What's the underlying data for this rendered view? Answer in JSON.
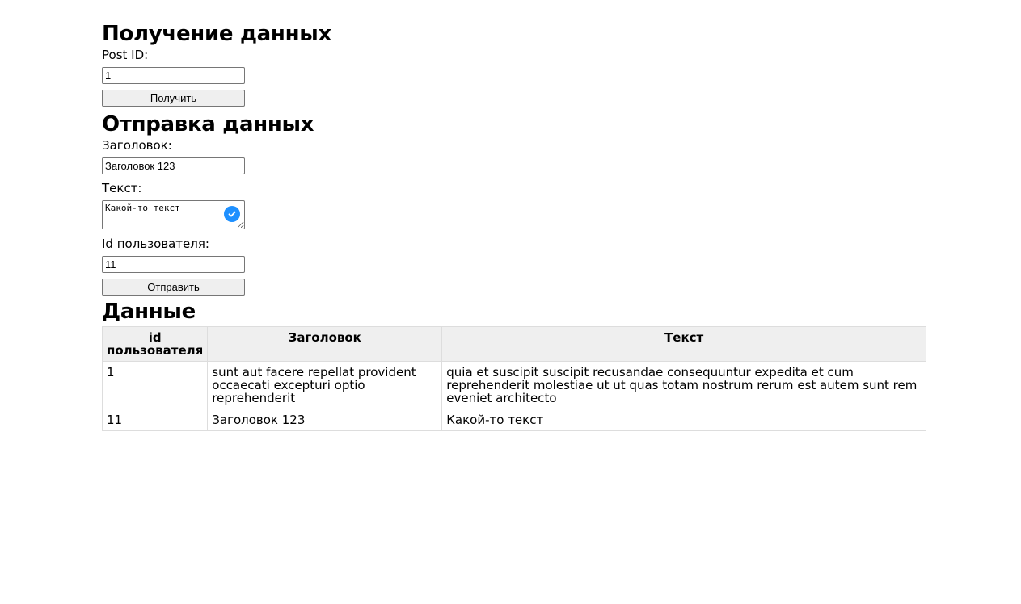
{
  "fetch_section": {
    "heading": "Получение данных",
    "post_id_label": "Post ID:",
    "post_id_value": "1",
    "fetch_button": "Получить"
  },
  "send_section": {
    "heading": "Отправка данных",
    "title_label": "Заголовок:",
    "title_value": "Заголовок 123",
    "text_label": "Текст:",
    "text_value": "Какой-то текст",
    "user_id_label": "Id пользователя:",
    "user_id_value": "11",
    "send_button": "Отправить"
  },
  "data_section": {
    "heading": "Данные",
    "columns": [
      "id пользователя",
      "Заголовок",
      "Текст"
    ],
    "rows": [
      {
        "user_id": "1",
        "title": "sunt aut facere repellat provident occaecati excepturi optio reprehenderit",
        "text": "quia et suscipit suscipit recusandae consequuntur expedita et cum reprehenderit molestiae ut ut quas totam nostrum rerum est autem sunt rem eveniet architecto"
      },
      {
        "user_id": "11",
        "title": "Заголовок 123",
        "text": "Какой-то текст"
      }
    ]
  },
  "icons": {
    "textarea_badge": "check-circle-icon"
  },
  "colors": {
    "badge": "#1e90ff",
    "table_header_bg": "#efefef",
    "table_border": "#dddddd"
  }
}
